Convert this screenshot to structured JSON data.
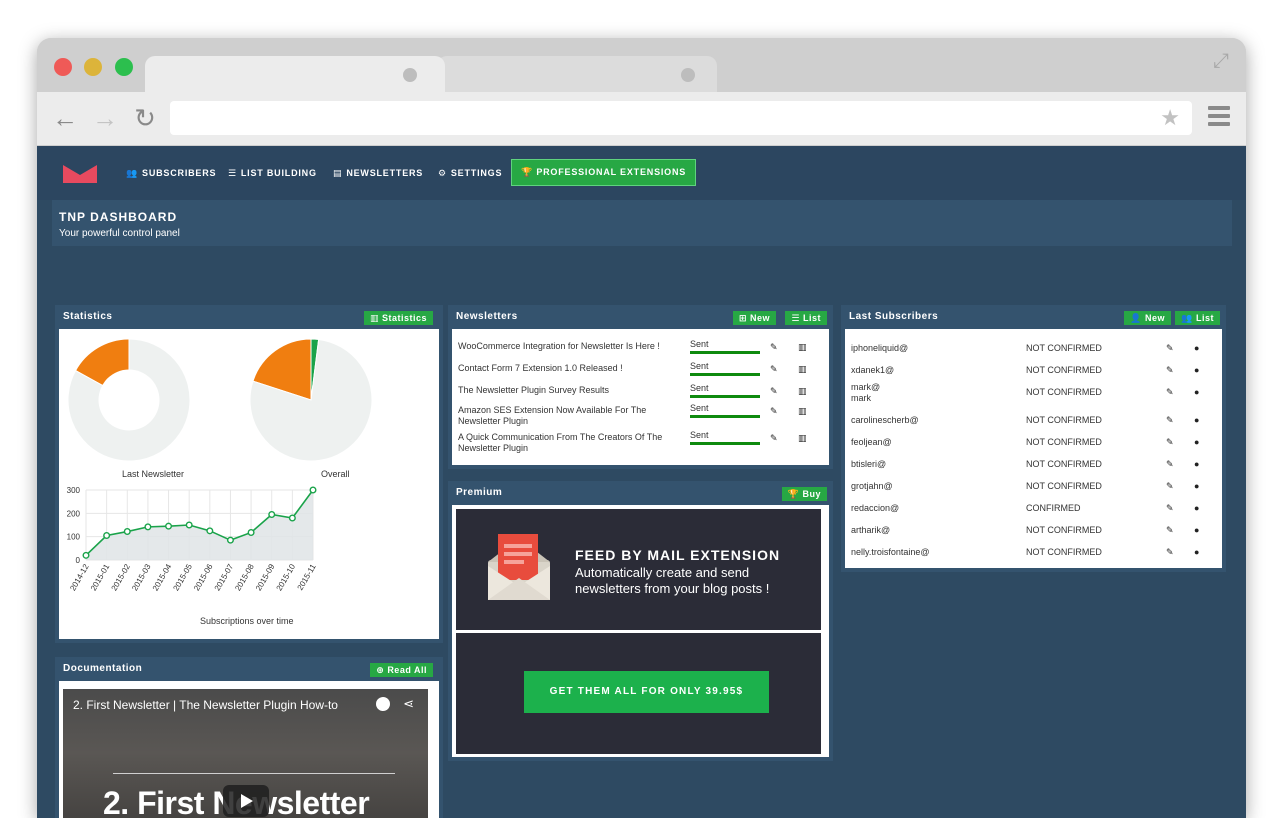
{
  "nav": {
    "items": [
      {
        "label": "SUBSCRIBERS",
        "icon": "users-icon"
      },
      {
        "label": "LIST BUILDING",
        "icon": "list-icon"
      },
      {
        "label": "NEWSLETTERS",
        "icon": "newspaper-icon"
      },
      {
        "label": "SETTINGS",
        "icon": "gear-icon"
      }
    ],
    "pro_label": "PROFESSIONAL EXTENSIONS"
  },
  "dashboard": {
    "title": "TNP DASHBOARD",
    "subtitle": "Your powerful control panel"
  },
  "statistics": {
    "title": "Statistics",
    "button": "Statistics",
    "pie1_label": "Last Newsletter",
    "pie2_label": "Overall",
    "line_label": "Subscriptions over time"
  },
  "chart_data": [
    {
      "type": "pie",
      "title": "Last Newsletter",
      "donut": true,
      "values": [
        0.17,
        0.83
      ],
      "colors": [
        "#f07e10",
        "#eef1f0"
      ]
    },
    {
      "type": "pie",
      "title": "Overall",
      "values": [
        0.2,
        0.02,
        0.78
      ],
      "colors": [
        "#f07e10",
        "#1aa34a",
        "#eef1f0"
      ]
    },
    {
      "type": "area",
      "title": "Subscriptions over time",
      "x": [
        "2014-12",
        "2015-01",
        "2015-02",
        "2015-03",
        "2015-04",
        "2015-05",
        "2015-06",
        "2015-07",
        "2015-08",
        "2015-09",
        "2015-10",
        "2015-11"
      ],
      "values": [
        20,
        105,
        122,
        142,
        145,
        150,
        125,
        85,
        118,
        195,
        180,
        300
      ],
      "ylim": [
        0,
        300
      ],
      "yticks": [
        0,
        100,
        200,
        300
      ],
      "color": "#1aa34a"
    }
  ],
  "newsletters": {
    "title": "Newsletters",
    "btn_new": "New",
    "btn_list": "List",
    "rows": [
      {
        "subject": "WooCommerce Integration for Newsletter Is Here !",
        "status": "Sent"
      },
      {
        "subject": "Contact Form 7 Extension 1.0 Released !",
        "status": "Sent"
      },
      {
        "subject": "The Newsletter Plugin Survey Results",
        "status": "Sent"
      },
      {
        "subject": "Amazon SES Extension Now Available For The Newsletter Plugin",
        "status": "Sent"
      },
      {
        "subject": "A Quick Communication From The Creators Of The Newsletter Plugin",
        "status": "Sent"
      }
    ]
  },
  "premium": {
    "title": "Premium",
    "button": "Buy",
    "headline": "FEED BY MAIL EXTENSION",
    "text": "Automatically create and send newsletters from your blog posts !",
    "cta": "GET THEM ALL FOR ONLY 39.95$"
  },
  "subscribers": {
    "title": "Last Subscribers",
    "btn_new": "New",
    "btn_list": "List",
    "rows": [
      {
        "email": "iphoneliquid@",
        "status": "NOT CONFIRMED"
      },
      {
        "email": "xdanek1@",
        "status": "NOT CONFIRMED"
      },
      {
        "email": "mark@ mark",
        "status": "NOT CONFIRMED"
      },
      {
        "email": "carolinescherb@",
        "status": "NOT CONFIRMED"
      },
      {
        "email": "feoljean@",
        "status": "NOT CONFIRMED"
      },
      {
        "email": "btisleri@",
        "status": "NOT CONFIRMED"
      },
      {
        "email": "grotjahn@",
        "status": "NOT CONFIRMED"
      },
      {
        "email": "redaccion@",
        "status": "CONFIRMED"
      },
      {
        "email": "artharik@",
        "status": "NOT CONFIRMED"
      },
      {
        "email": "nelly.troisfontaine@",
        "status": "NOT CONFIRMED"
      }
    ]
  },
  "documentation": {
    "title": "Documentation",
    "button": "Read All",
    "video_title": "2. First Newsletter | The Newsletter Plugin How-to",
    "video_big": "2. First Newsletter"
  }
}
